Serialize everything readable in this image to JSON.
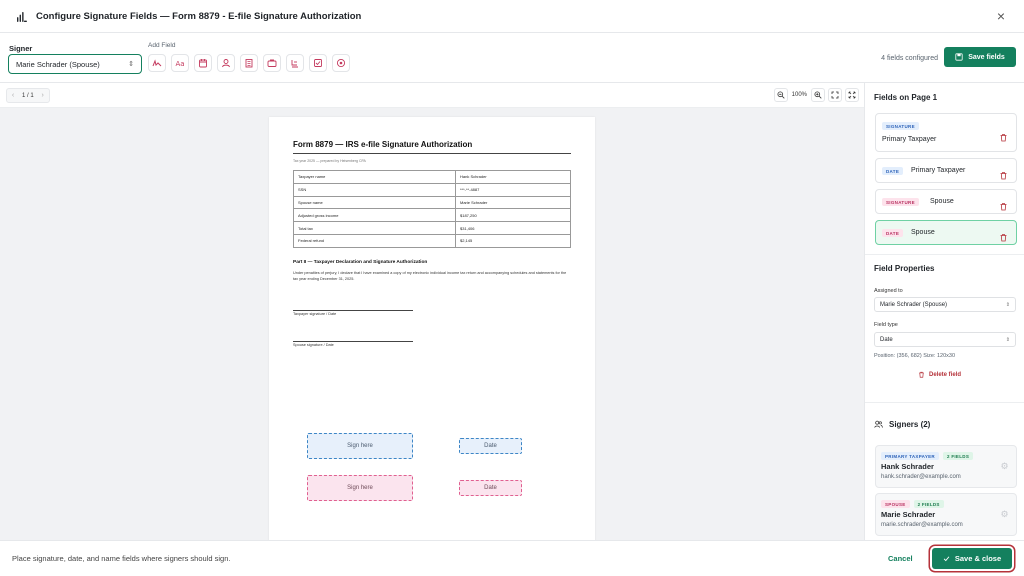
{
  "header": {
    "title": "Configure Signature Fields — Form 8879 - E-file Signature Authorization",
    "close_icon": "×"
  },
  "toolbar": {
    "signer_label": "Signer",
    "signer_value": "Marie Schrader (Spouse)",
    "add_field_label": "Add Field",
    "tools": [
      "signature-icon",
      "initials-icon",
      "date-icon",
      "name-icon",
      "company-icon",
      "title-icon",
      "text-icon",
      "checkbox-icon",
      "radio-icon"
    ],
    "fields_configured": "4 fields configured",
    "save_fields_label": "Save fields",
    "accent": "#14805e"
  },
  "viewer": {
    "page_indicator": "1 / 1",
    "zoom": "100%"
  },
  "document": {
    "title": "Form 8879 — IRS e-file Signature Authorization",
    "subtitle": "Tax year 2025 — prepared by Heisenberg CPA",
    "rows": [
      {
        "k": "Taxpayer name",
        "v": "Hank Schrader"
      },
      {
        "k": "SSN",
        "v": "***-**-4887"
      },
      {
        "k": "Spouse name",
        "v": "Marie Schrader"
      },
      {
        "k": "Adjusted gross income",
        "v": "$187,250"
      },
      {
        "k": "Total tax",
        "v": "$31,406"
      },
      {
        "k": "Federal refund",
        "v": "$2,145"
      }
    ],
    "part2_heading": "Part II — Taxpayer Declaration and Signature Authorization",
    "part2_text": "Under penalties of perjury, I declare that I have examined a copy of my electronic individual income tax return and accompanying schedules and statements for the tax year ending December 31, 2025.",
    "taxpayer_sig_caption": "Taxpayer signature / Date",
    "spouse_sig_caption": "Spouse signature / Date",
    "placed_fields": {
      "primary_sign": "Sign here",
      "primary_date": "Date",
      "spouse_sign": "Sign here",
      "spouse_date": "Date"
    }
  },
  "bottom": {
    "hint": "Place signature, date, and name fields where signers should sign.",
    "cancel_label": "Cancel",
    "save_close_label": "Save & close"
  },
  "sidebar": {
    "fields_heading": "Fields on Page 1",
    "fields": [
      {
        "badge": "SIGNATURE",
        "label": "Primary Taxpayer",
        "color": "#2c62b8"
      },
      {
        "badge": "DATE",
        "label": "Primary Taxpayer",
        "color": "#2c62b8"
      },
      {
        "badge": "SIGNATURE",
        "label": "Spouse",
        "color": "#b83060"
      },
      {
        "badge": "DATE",
        "label": "Spouse",
        "color": "#b83060"
      }
    ],
    "properties_heading": "Field Properties",
    "assigned_to_label": "Assigned to",
    "assigned_to_value": "Marie Schrader (Spouse)",
    "field_type_label": "Field type",
    "field_type_value": "Date",
    "position_text": "Position: (356, 682)   Size: 120x30",
    "delete_field_label": "Delete field",
    "signers_heading": "Signers (2)",
    "signers": [
      {
        "role": "PRIMARY TAXPAYER",
        "count": "2 FIELDS",
        "name": "Hank Schrader",
        "email": "hank.schrader@example.com"
      },
      {
        "role": "SPOUSE",
        "count": "2 FIELDS",
        "name": "Marie Schrader",
        "email": "marie.schrader@example.com"
      }
    ]
  }
}
